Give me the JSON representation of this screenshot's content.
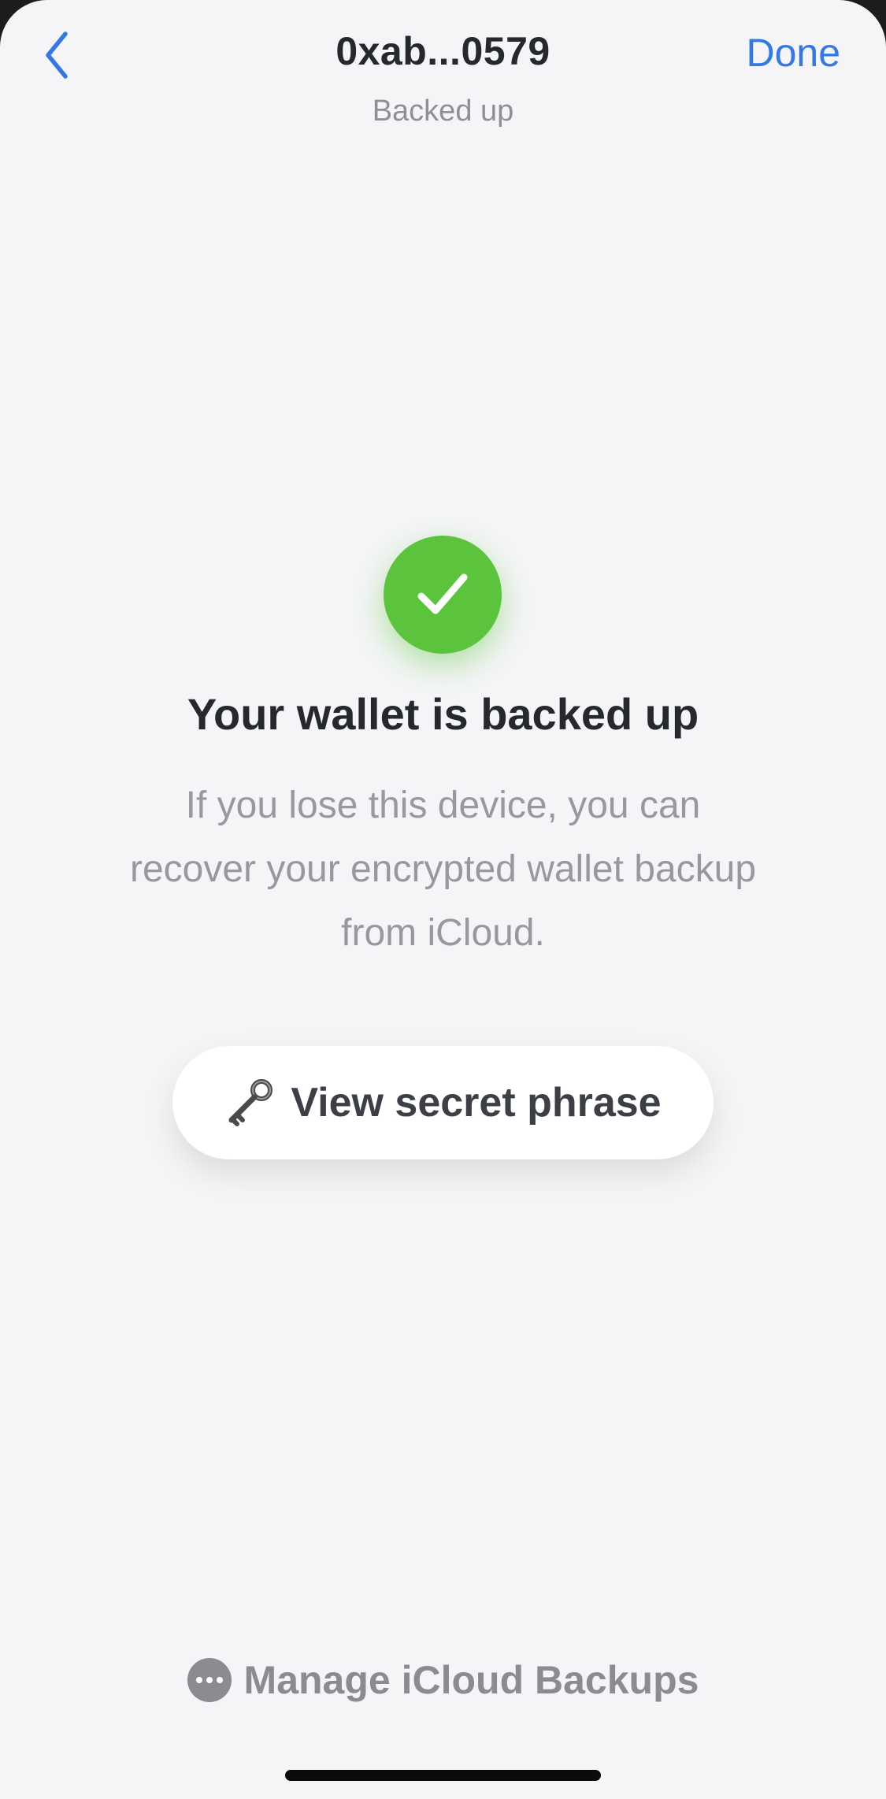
{
  "header": {
    "title": "0xab...0579",
    "subtitle": "Backed up",
    "done_label": "Done",
    "back_icon": "chevron-left-icon"
  },
  "status": {
    "icon": "checkmark-icon",
    "title": "Your wallet is backed up",
    "description": "If you lose this device, you can recover your encrypted wallet backup from iCloud."
  },
  "secret_button": {
    "icon": "key-icon",
    "label": "View secret phrase"
  },
  "manage_button": {
    "icon": "more-icon",
    "label": "Manage iCloud Backups"
  },
  "colors": {
    "accent": "#3478e6",
    "success": "#5cc43c",
    "background": "#f5f5f7"
  }
}
